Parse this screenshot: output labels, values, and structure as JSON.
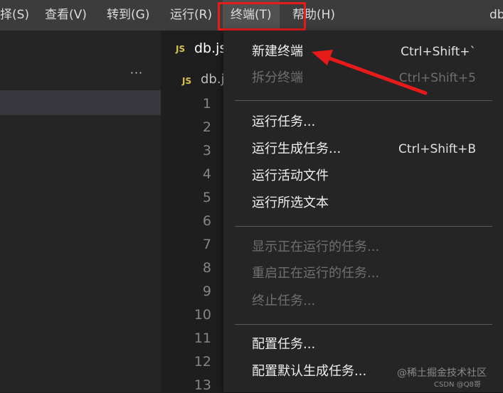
{
  "menubar": {
    "items": [
      "择(S)",
      "查看(V)",
      "转到(G)",
      "运行(R)",
      "终端(T)",
      "帮助(H)"
    ],
    "right_text": "db"
  },
  "sidebar": {
    "more_label": "···"
  },
  "tab": {
    "badge": "JS",
    "label": "db.js"
  },
  "breadcrumb": {
    "badge": "JS",
    "label": "db.j"
  },
  "line_numbers": [
    "1",
    "2",
    "3",
    "4",
    "5",
    "6",
    "7",
    "8",
    "9",
    "10",
    "11",
    "12",
    "13"
  ],
  "menu": {
    "items": [
      {
        "label": "新建终端",
        "shortcut": "Ctrl+Shift+`",
        "disabled": false
      },
      {
        "label": "拆分终端",
        "shortcut": "Ctrl+Shift+5",
        "disabled": true
      },
      {
        "label": "运行任务...",
        "shortcut": "",
        "disabled": false
      },
      {
        "label": "运行生成任务...",
        "shortcut": "Ctrl+Shift+B",
        "disabled": false
      },
      {
        "label": "运行活动文件",
        "shortcut": "",
        "disabled": false
      },
      {
        "label": "运行所选文本",
        "shortcut": "",
        "disabled": false
      },
      {
        "label": "显示正在运行的任务...",
        "shortcut": "",
        "disabled": true
      },
      {
        "label": "重启正在运行的任务...",
        "shortcut": "",
        "disabled": true
      },
      {
        "label": "终止任务...",
        "shortcut": "",
        "disabled": true
      },
      {
        "label": "配置任务...",
        "shortcut": "",
        "disabled": false
      },
      {
        "label": "配置默认生成任务...",
        "shortcut": "",
        "disabled": false
      }
    ]
  },
  "watermark": "@稀土掘金技术社区",
  "csdn": "CSDN @Q8哥",
  "colors": {
    "annotation_red": "#e81b1b",
    "menu_bg": "#252526",
    "menubar_bg": "#3c3c3c"
  }
}
